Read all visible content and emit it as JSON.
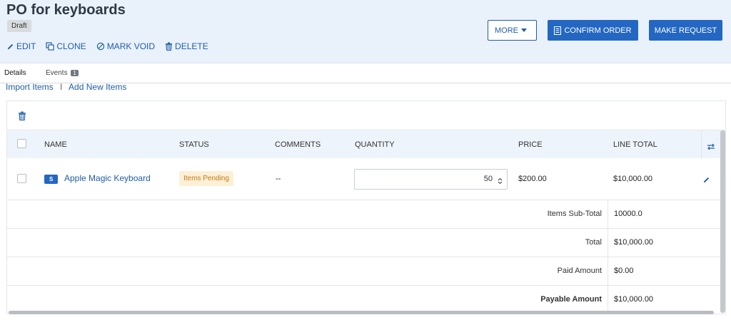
{
  "header": {
    "title": "PO for keyboards",
    "status_badge": "Draft",
    "actions": [
      "EDIT",
      "CLONE",
      "MARK VOID",
      "DELETE"
    ],
    "buttons": {
      "more": "MORE",
      "confirm": "CONFIRM ORDER",
      "request": "MAKE REQUEST"
    }
  },
  "tabs": {
    "details": "Details",
    "events": "Events",
    "events_count": "1"
  },
  "links": {
    "import": "Import Items",
    "separator": "I",
    "add": "Add New Items"
  },
  "table": {
    "columns": [
      "NAME",
      "STATUS",
      "COMMENTS",
      "QUANTITY",
      "PRICE",
      "LINE TOTAL"
    ],
    "rows": [
      {
        "type_badge": "S",
        "name": "Apple Magic Keyboard",
        "status": "Items Pending",
        "comments": "--",
        "quantity": "50",
        "price": "$200.00",
        "line_total": "$10,000.00"
      }
    ],
    "summary": [
      {
        "label": "Items Sub-Total",
        "value": "10000.0"
      },
      {
        "label": "Total",
        "value": "$10,000.00"
      },
      {
        "label": "Paid Amount",
        "value": "$0.00"
      },
      {
        "label": "Payable Amount",
        "value": "$10,000.00"
      }
    ]
  },
  "colors": {
    "header_bg": "#e9f1fb",
    "primary": "#2367c2",
    "link": "#1f5ea8",
    "pending_bg": "#fdf0d6",
    "pending_text": "#c07b1c"
  }
}
